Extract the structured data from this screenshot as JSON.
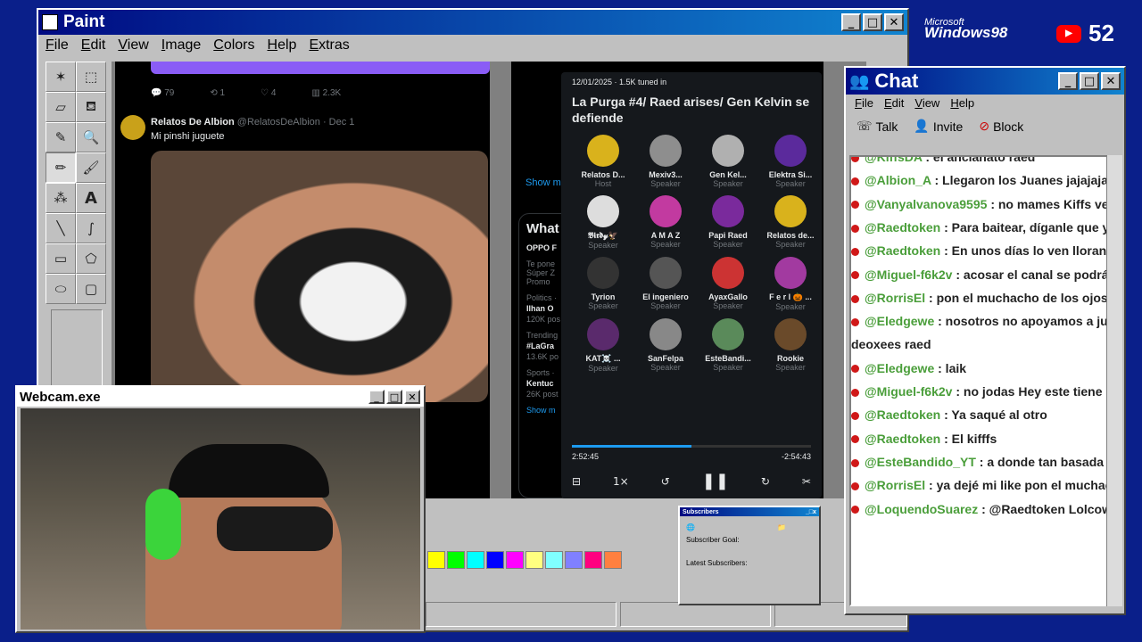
{
  "desktop": {
    "os_logo_small": "Microsoft",
    "os_logo": "Windows98",
    "youtube_count": "52"
  },
  "paint": {
    "title": "Paint",
    "menu": [
      "File",
      "Edit",
      "View",
      "Image",
      "Colors",
      "Help",
      "Extras"
    ],
    "palette_colors": [
      "#ffff00",
      "#00ff00",
      "#00ffff",
      "#0000ff",
      "#ff00ff",
      "#ffff80",
      "#80ffff",
      "#8080ff",
      "#ff0080",
      "#ff8040"
    ]
  },
  "tweet": {
    "actions": [
      "79",
      "1",
      "4",
      "2.3K"
    ],
    "author": "Relatos De Albion",
    "handle": "@RelatosDeAlbion · Dec 1",
    "text": "Mi pinshi juguete"
  },
  "sidebar": {
    "show_more": "Show m",
    "whats": "What",
    "trend1": "OPPO F",
    "trend1_sub": "Te pone",
    "trend1_sub2": "Súper Z",
    "promo": "Promo",
    "cat2": "Politics ·",
    "trend2": "Ilhan O",
    "count2": "120K pos",
    "cat3": "Trending",
    "trend3": "#LaGra",
    "count3": "13.6K po",
    "cat4": "Sports ·",
    "trend4": "Kentuc",
    "count4": "26K post",
    "show_more2": "Show m"
  },
  "space": {
    "meta": "12/01/2025 · 1.5K tuned in",
    "title": "La Purga #4/ Raed arises/ Gen Kelvin se defiende",
    "participants": [
      {
        "name": "Relatos D...",
        "role": "Host"
      },
      {
        "name": "Mexiv3...",
        "role": "Speaker"
      },
      {
        "name": "Gen Kel...",
        "role": "Speaker"
      },
      {
        "name": "Elektra Si...",
        "role": "Speaker"
      },
      {
        "name": "𝕭𝖎𝖗𝖉𝔂🦅",
        "role": "Speaker"
      },
      {
        "name": "A M A Z",
        "role": "Speaker"
      },
      {
        "name": "Papi Raed",
        "role": "Speaker"
      },
      {
        "name": "Relatos de...",
        "role": "Speaker"
      },
      {
        "name": "Tyrion",
        "role": "Speaker"
      },
      {
        "name": "El ingeniero",
        "role": "Speaker"
      },
      {
        "name": "AyaxGallo",
        "role": "Speaker"
      },
      {
        "name": "F e r l 🎃 ...",
        "role": "Speaker"
      },
      {
        "name": "KAT☠️ ...",
        "role": "Speaker"
      },
      {
        "name": "SanFelpa",
        "role": "Speaker"
      },
      {
        "name": "EsteBandi...",
        "role": "Speaker"
      },
      {
        "name": "Rookie",
        "role": "Speaker"
      }
    ],
    "avatar_colors": [
      "#d9b21c",
      "#8e8e8e",
      "#b0b0b0",
      "#5b2a9c",
      "#ddd",
      "#c23aa0",
      "#7a2a9c",
      "#d9b21c",
      "#333",
      "#555",
      "#c33",
      "#a23aa0",
      "#5a2a6c",
      "#888",
      "#5a8a5a",
      "#6a4a2a"
    ],
    "progress": 0.5,
    "elapsed": "2:52:45",
    "remaining": "-2:54:43",
    "speed": "1×"
  },
  "chat": {
    "title": "Chat",
    "menu": [
      "File",
      "Edit",
      "View",
      "Help"
    ],
    "tools": [
      "Talk",
      "Invite",
      "Block"
    ],
    "messages": [
      {
        "user": "@KiffsDA",
        "text": ": el ancianato raed"
      },
      {
        "user": "@Albion_A",
        "text": ": Llegaron los Juanes jajajaja"
      },
      {
        "user": "@Vanyalvanova9595",
        "text": ": no mames Kiffs vete a bai"
      },
      {
        "user": "@Raedtoken",
        "text": ": Para baitear, díganle que ya lo"
      },
      {
        "user": "@Raedtoken",
        "text": ": En unos días lo ven llorando c"
      },
      {
        "user": "@Miguel-f6k2v",
        "text": ": acosar el canal se podrá denunc"
      },
      {
        "user": "@RorrisEl",
        "text": ": pon el muchacho de los ojos tristes 💧"
      },
      {
        "user": "@Eledgewe",
        "text": ": nosotros no apoyamos a juanarka, c"
      },
      {
        "user": "",
        "text": "deoxees raed"
      },
      {
        "user": "@Eledgewe",
        "text": ": laik"
      },
      {
        "user": "@Miguel-f6k2v",
        "text": ": no jodas Hey este tiene la foto c"
      },
      {
        "user": "@Raedtoken",
        "text": ": Ya saqué al otro"
      },
      {
        "user": "@Raedtoken",
        "text": ": El kifffs"
      },
      {
        "user": "@EsteBandido_YT",
        "text": ": a donde tan basada ?"
      },
      {
        "user": "@RorrisEl",
        "text": ": ya dejé mi like pon el muchacho de lo"
      },
      {
        "user": "@LoquendoSuarez",
        "text": ": @Raedtoken Lolcow"
      }
    ]
  },
  "webcam": {
    "title": "Webcam.exe"
  },
  "subscribers": {
    "title": "Subscribers",
    "goal": "Subscriber Goal:",
    "latest": "Latest Subscribers:"
  }
}
